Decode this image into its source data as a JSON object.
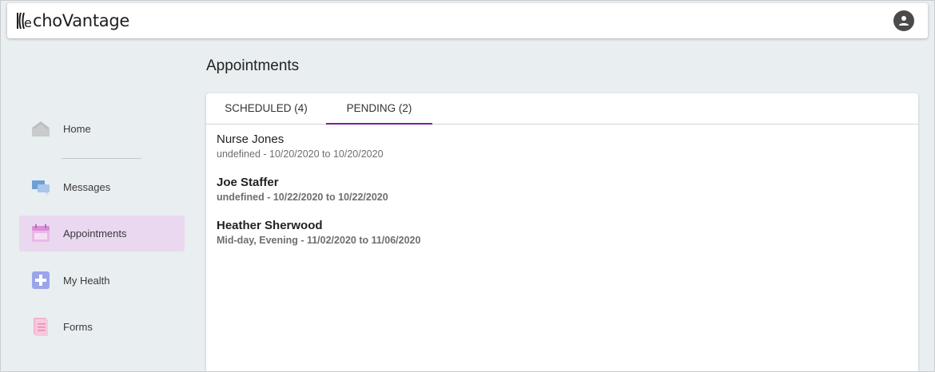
{
  "header": {
    "logo_text": "choVantage",
    "logo_mark": "e",
    "avatar_icon": "user-avatar-icon"
  },
  "sidebar": {
    "items": [
      {
        "label": "Home",
        "icon": "home-icon"
      },
      {
        "label": "Messages",
        "icon": "messages-icon"
      },
      {
        "label": "Appointments",
        "icon": "calendar-icon",
        "active": true
      },
      {
        "label": "My Health",
        "icon": "health-plus-icon"
      },
      {
        "label": "Forms",
        "icon": "forms-icon"
      }
    ]
  },
  "main": {
    "title": "Appointments",
    "tabs": [
      {
        "label": "SCHEDULED (4)"
      },
      {
        "label": "PENDING (2)",
        "active": true
      }
    ],
    "appointments": [
      {
        "name": "Nurse Jones",
        "detail": "undefined - 10/20/2020 to 10/20/2020",
        "bold": false
      },
      {
        "name": "Joe Staffer",
        "detail": "undefined - 10/22/2020 to 10/22/2020",
        "bold": true
      },
      {
        "name": "Heather Sherwood",
        "detail": "Mid-day, Evening - 11/02/2020 to 11/06/2020",
        "bold": true
      }
    ]
  },
  "colors": {
    "accent": "#7b1fa2",
    "active_nav_bg": "#ead8f0",
    "page_bg": "#e9eef0"
  }
}
